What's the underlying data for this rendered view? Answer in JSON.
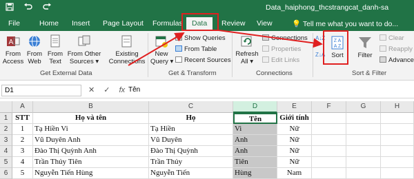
{
  "title_bar": {
    "save_icon": "save-icon",
    "undo_icon": "undo-icon",
    "redo_icon": "redo-icon",
    "document_title": "Data_haiphong_thcstrangcat_danh-sa"
  },
  "tabs": [
    "File",
    "Home",
    "Insert",
    "Page Layout",
    "Formulas",
    "Data",
    "Review",
    "View"
  ],
  "tell_me": "Tell me what you want to do...",
  "ribbon": {
    "get_external_data": {
      "label": "Get External Data",
      "buttons": [
        {
          "l1": "From",
          "l2": "Access"
        },
        {
          "l1": "From",
          "l2": "Web"
        },
        {
          "l1": "From",
          "l2": "Text"
        },
        {
          "l1": "From Other",
          "l2": "Sources ▾"
        },
        {
          "l1": "Existing",
          "l2": "Connections"
        }
      ]
    },
    "get_transform": {
      "label": "Get & Transform",
      "new_query": {
        "l1": "New",
        "l2": "Query ▾"
      },
      "items": [
        "Show Queries",
        "From Table",
        "Recent Sources"
      ]
    },
    "connections": {
      "label": "Connections",
      "refresh": {
        "l1": "Refresh",
        "l2": "All ▾"
      },
      "items": [
        "Connections",
        "Properties",
        "Edit Links"
      ]
    },
    "sort_filter": {
      "label": "Sort & Filter",
      "az_top": "A↓Z",
      "az_bottom": "Z↓A",
      "sort": "Sort",
      "filter": "Filter",
      "items": [
        "Clear",
        "Reapply",
        "Advanced"
      ]
    }
  },
  "formula_bar": {
    "name_box": "D1",
    "cancel": "✕",
    "enter": "✓",
    "fx": "fx",
    "content": "Tên"
  },
  "columns": [
    "A",
    "B",
    "C",
    "D",
    "E",
    "F",
    "G",
    "H"
  ],
  "rows": [
    {
      "num": "1",
      "stt": "STT",
      "full": "Họ và tên",
      "ho": "Họ",
      "ten": "Tên",
      "gt": "Giới tính"
    },
    {
      "num": "2",
      "stt": "1",
      "full": "Tạ Hiền  Vi",
      "ho": "Tạ Hiền",
      "ten": "Vi",
      "gt": "Nữ"
    },
    {
      "num": "3",
      "stt": "2",
      "full": "Vũ Duyên Anh",
      "ho": "Vũ Duyên",
      "ten": "Anh",
      "gt": "Nữ"
    },
    {
      "num": "4",
      "stt": "3",
      "full": "Đào Thị Quỳnh  Anh",
      "ho": "Đào Thị Quỳnh",
      "ten": "Anh",
      "gt": "Nữ"
    },
    {
      "num": "5",
      "stt": "4",
      "full": "Trần Thủy  Tiên",
      "ho": "Trần Thủy",
      "ten": "Tiên",
      "gt": "Nữ"
    },
    {
      "num": "6",
      "stt": "5",
      "full": "Nguyễn Tiến  Hùng",
      "ho": "Nguyễn Tiến",
      "ten": "Hùng",
      "gt": "Nam"
    }
  ],
  "colors": {
    "excel_green": "#217346",
    "annotation_red": "#e02020"
  }
}
